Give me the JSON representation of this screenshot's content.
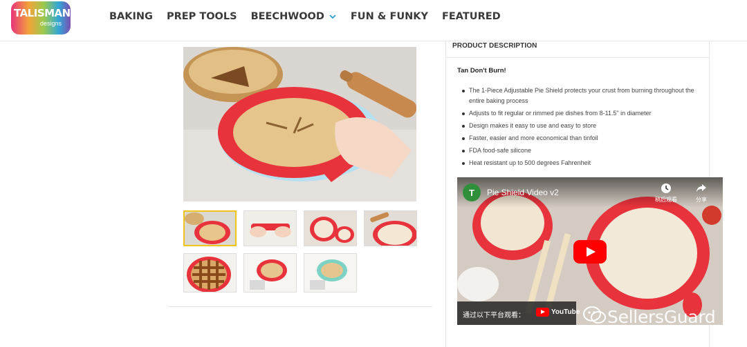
{
  "brand": {
    "name": "TALISMAN",
    "sub": "designs"
  },
  "nav": {
    "items": [
      {
        "label": "BAKING"
      },
      {
        "label": "PREP TOOLS"
      },
      {
        "label": "BEECHWOOD",
        "has_dropdown": true
      },
      {
        "label": "FUN & FUNKY"
      },
      {
        "label": "FEATURED"
      }
    ]
  },
  "product": {
    "description_heading": "PRODUCT DESCRIPTION",
    "tagline": "Tan Don't Burn!",
    "bullets": [
      "The 1-Piece Adjustable Pie Shield protects your crust from burning throughout the entire baking process",
      "Adjusts to fit regular or rimmed pie dishes from 8-11.5\" in diameter",
      "Design makes it easy to use and easy to store",
      "Faster, easier and more economical than tinfoil",
      "FDA food-safe silicone",
      "Heat resistant up to 500 degrees Fahrenheit"
    ]
  },
  "gallery": {
    "thumb_count": 7,
    "active_index": 0
  },
  "video": {
    "channel_initial": "T",
    "title": "Pie Shield Video v2",
    "watch_later_label": "稍后观看",
    "share_label": "分享",
    "watch_on_label": "通过以下平台观看：",
    "youtube_label": "YouTube"
  },
  "watermark": {
    "text": "SellersGuard"
  },
  "colors": {
    "accent_red": "#e8333c",
    "active_thumb_border": "#f0c419",
    "youtube_red": "#ff0000"
  }
}
